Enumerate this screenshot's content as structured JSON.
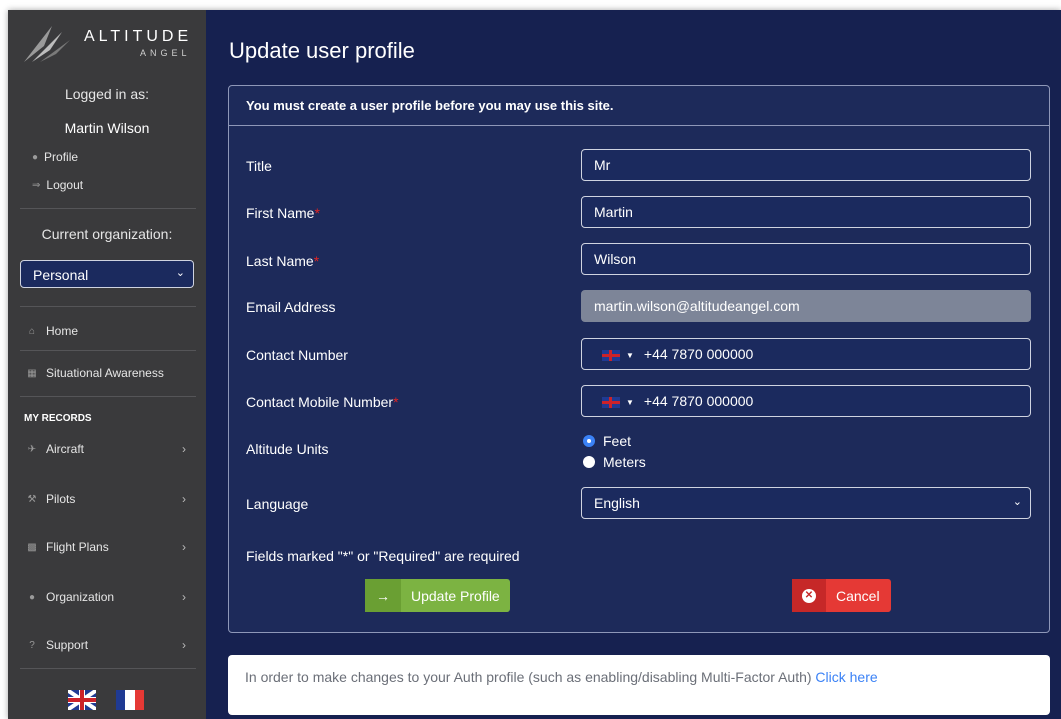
{
  "brand": {
    "name": "ALTITUDE",
    "sub": "ANGEL"
  },
  "sidebar": {
    "logged_in_label": "Logged in as:",
    "user_name": "Martin Wilson",
    "profile_link": "Profile",
    "logout_link": "Logout",
    "org_label": "Current organization:",
    "org_selected": "Personal",
    "nav": {
      "home": "Home",
      "situational": "Situational Awareness",
      "section": "MY RECORDS",
      "aircraft": "Aircraft",
      "pilots": "Pilots",
      "flight_plans": "Flight Plans",
      "organization": "Organization",
      "support": "Support"
    },
    "languages": [
      "en",
      "fr"
    ]
  },
  "main": {
    "title": "Update user profile",
    "notice": "You must create a user profile before you may use this site.",
    "fields": {
      "title": {
        "label": "Title",
        "value": "Mr"
      },
      "first_name": {
        "label": "First Name",
        "value": "Martin"
      },
      "last_name": {
        "label": "Last Name",
        "value": "Wilson"
      },
      "email": {
        "label": "Email Address",
        "value": "martin.wilson@altitudeangel.com"
      },
      "contact_number": {
        "label": "Contact Number",
        "value": "+44 7870 000000"
      },
      "mobile_number": {
        "label": "Contact Mobile Number",
        "value": "+44 7870 000000"
      },
      "altitude_units": {
        "label": "Altitude Units",
        "options": [
          "Feet",
          "Meters"
        ],
        "selected": "Feet"
      },
      "language": {
        "label": "Language",
        "value": "English"
      }
    },
    "required_marker": "*",
    "required_note": "Fields marked \"*\" or \"Required\" are required",
    "update_button": "Update Profile",
    "cancel_button": "Cancel",
    "auth_info": "In order to make changes to your Auth profile (such as enabling/disabling Multi-Factor Auth)",
    "auth_link": "Click here"
  }
}
